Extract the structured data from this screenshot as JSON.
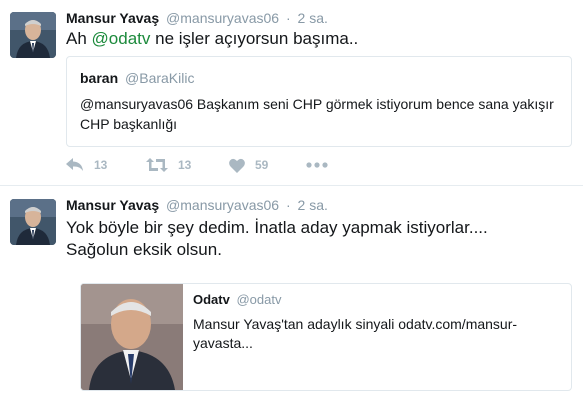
{
  "tweet1": {
    "author_name": "Mansur Yavaş",
    "author_handle": "@mansuryavas06",
    "separator": "·",
    "time": "2 sa.",
    "text_prefix": "Ah ",
    "text_mention": "@odatv",
    "text_suffix": " ne işler açıyorsun başıma..",
    "quote": {
      "author_name": "baran",
      "author_handle": "@BaraKilic",
      "text": "@mansuryavas06 Başkanım seni CHP görmek istiyorum bence sana yakışır CHP başkanlığı"
    },
    "actions": {
      "reply_count": "13",
      "retweet_count": "13",
      "like_count": "59"
    }
  },
  "tweet2": {
    "author_name": "Mansur Yavaş",
    "author_handle": "@mansuryavas06",
    "separator": "·",
    "time": "2 sa.",
    "text_line1": "Yok böyle bir şey dedim. İnatla aday yapmak istiyorlar....",
    "text_line2": "Sağolun eksik olsun.",
    "card": {
      "author_name": "Odatv",
      "author_handle": "@odatv",
      "text": "Mansur Yavaş'tan adaylık sinyali odatv.com/mansur-yavasta..."
    }
  },
  "colors": {
    "text": "#14171a",
    "muted": "#8899a6",
    "mention": "#1c8a3c",
    "action_icon": "#aab8c2",
    "border": "#e1e8ed"
  },
  "icons": {
    "reply": "reply-icon",
    "retweet": "retweet-icon",
    "like": "heart-icon",
    "more": "more-dots-icon"
  }
}
